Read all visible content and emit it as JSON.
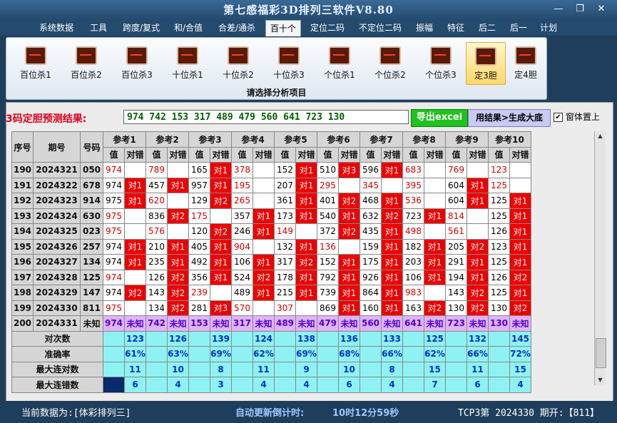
{
  "app_title": "第七感福彩3D排列三软件V8.80",
  "window_buttons": {
    "minimize": "—",
    "restore": "❐",
    "close": "✕"
  },
  "menu": [
    "系统数据",
    "工具",
    "跨度/复式",
    "和/合值",
    "合差/通杀",
    "百十个",
    "定位二码",
    "不定位二码",
    "振幅",
    "特征",
    "后二",
    "后一",
    "计划"
  ],
  "active_menu": "百十个",
  "tools": [
    "百位杀1",
    "百位杀2",
    "百位杀3",
    "十位杀1",
    "十位杀2",
    "十位杀3",
    "个位杀1",
    "个位杀2",
    "个位杀3",
    "定3胆",
    "定4胆"
  ],
  "selected_tool": "定3胆",
  "tool_caption": "请选择分析项目",
  "result": {
    "label": "3码定胆预测结果:",
    "value": "974 742 153 317 489 479 560 641 723 130",
    "export_button": "导出excel",
    "generate_button": "用结果>生成大底",
    "checkbox_label": "窗体置上",
    "checkbox_checked": true
  },
  "table": {
    "head_left": [
      "序号",
      "期号",
      "号码"
    ],
    "ref_headers": [
      "参考1",
      "参考2",
      "参考3",
      "参考4",
      "参考5",
      "参考6",
      "参考7",
      "参考8",
      "参考9",
      "参考10"
    ],
    "sub_headers": [
      "值",
      "对错"
    ],
    "rows": [
      {
        "seq": "190",
        "issue": "2024321",
        "num": "050",
        "refs": [
          [
            "974",
            "",
            1
          ],
          [
            "789",
            "",
            1
          ],
          [
            "165",
            "对1",
            0
          ],
          [
            "378",
            "",
            1
          ],
          [
            "152",
            "对1",
            0
          ],
          [
            "510",
            "对3",
            0
          ],
          [
            "596",
            "对1",
            0
          ],
          [
            "683",
            "",
            1
          ],
          [
            "769",
            "",
            1
          ],
          [
            "123",
            "",
            1
          ]
        ]
      },
      {
        "seq": "191",
        "issue": "2024322",
        "num": "678",
        "refs": [
          [
            "974",
            "对1",
            0
          ],
          [
            "457",
            "对1",
            0
          ],
          [
            "957",
            "对1",
            0
          ],
          [
            "195",
            "",
            1
          ],
          [
            "207",
            "对1",
            0
          ],
          [
            "295",
            "",
            1
          ],
          [
            "345",
            "",
            1
          ],
          [
            "395",
            "",
            1
          ],
          [
            "604",
            "对1",
            0
          ],
          [
            "125",
            "",
            1
          ]
        ]
      },
      {
        "seq": "192",
        "issue": "2024323",
        "num": "914",
        "refs": [
          [
            "975",
            "对1",
            0
          ],
          [
            "620",
            "",
            1
          ],
          [
            "129",
            "对2",
            0
          ],
          [
            "265",
            "",
            1
          ],
          [
            "361",
            "对1",
            0
          ],
          [
            "401",
            "对2",
            0
          ],
          [
            "468",
            "对1",
            0
          ],
          [
            "536",
            "",
            1
          ],
          [
            "604",
            "对1",
            0
          ],
          [
            "125",
            "对1",
            0
          ]
        ]
      },
      {
        "seq": "193",
        "issue": "2024324",
        "num": "630",
        "refs": [
          [
            "975",
            "",
            1
          ],
          [
            "836",
            "对2",
            0
          ],
          [
            "175",
            "",
            1
          ],
          [
            "357",
            "对1",
            0
          ],
          [
            "173",
            "对1",
            0
          ],
          [
            "540",
            "对1",
            0
          ],
          [
            "632",
            "对2",
            0
          ],
          [
            "723",
            "对1",
            0
          ],
          [
            "814",
            "",
            1
          ],
          [
            "125",
            "对1",
            0
          ]
        ]
      },
      {
        "seq": "194",
        "issue": "2024325",
        "num": "023",
        "refs": [
          [
            "975",
            "",
            1
          ],
          [
            "576",
            "",
            1
          ],
          [
            "120",
            "对2",
            0
          ],
          [
            "246",
            "对1",
            0
          ],
          [
            "149",
            "",
            1
          ],
          [
            "372",
            "对2",
            0
          ],
          [
            "435",
            "对1",
            0
          ],
          [
            "498",
            "",
            1
          ],
          [
            "561",
            "",
            1
          ],
          [
            "126",
            "对1",
            0
          ]
        ]
      },
      {
        "seq": "195",
        "issue": "2024326",
        "num": "257",
        "refs": [
          [
            "974",
            "对1",
            0
          ],
          [
            "210",
            "对1",
            0
          ],
          [
            "405",
            "对1",
            0
          ],
          [
            "904",
            "",
            1
          ],
          [
            "132",
            "对1",
            0
          ],
          [
            "136",
            "",
            1
          ],
          [
            "159",
            "对1",
            0
          ],
          [
            "182",
            "对1",
            0
          ],
          [
            "205",
            "对2",
            0
          ],
          [
            "123",
            "对1",
            0
          ]
        ]
      },
      {
        "seq": "196",
        "issue": "2024327",
        "num": "134",
        "refs": [
          [
            "974",
            "对1",
            0
          ],
          [
            "235",
            "对1",
            0
          ],
          [
            "492",
            "对1",
            0
          ],
          [
            "106",
            "对1",
            0
          ],
          [
            "317",
            "对2",
            0
          ],
          [
            "152",
            "对1",
            0
          ],
          [
            "175",
            "对1",
            0
          ],
          [
            "203",
            "对1",
            0
          ],
          [
            "291",
            "对1",
            0
          ],
          [
            "125",
            "对1",
            0
          ]
        ]
      },
      {
        "seq": "197",
        "issue": "2024328",
        "num": "125",
        "refs": [
          [
            "974",
            "",
            1
          ],
          [
            "126",
            "对2",
            0
          ],
          [
            "356",
            "对1",
            0
          ],
          [
            "524",
            "对2",
            0
          ],
          [
            "178",
            "对1",
            0
          ],
          [
            "792",
            "对1",
            0
          ],
          [
            "926",
            "对1",
            0
          ],
          [
            "106",
            "对1",
            0
          ],
          [
            "194",
            "对1",
            0
          ],
          [
            "126",
            "对2",
            0
          ]
        ]
      },
      {
        "seq": "198",
        "issue": "2024329",
        "num": "147",
        "refs": [
          [
            "974",
            "对2",
            0
          ],
          [
            "143",
            "对2",
            0
          ],
          [
            "239",
            "",
            1
          ],
          [
            "489",
            "对1",
            0
          ],
          [
            "215",
            "对1",
            0
          ],
          [
            "739",
            "对1",
            0
          ],
          [
            "864",
            "对1",
            0
          ],
          [
            "983",
            "",
            1
          ],
          [
            "143",
            "对2",
            0
          ],
          [
            "125",
            "对1",
            0
          ]
        ]
      },
      {
        "seq": "199",
        "issue": "2024330",
        "num": "811",
        "refs": [
          [
            "975",
            "",
            1
          ],
          [
            "134",
            "对2",
            0
          ],
          [
            "281",
            "对3",
            0
          ],
          [
            "570",
            "",
            1
          ],
          [
            "307",
            "",
            1
          ],
          [
            "869",
            "对1",
            0
          ],
          [
            "160",
            "对1",
            0
          ],
          [
            "163",
            "对2",
            0
          ],
          [
            "130",
            "对2",
            0
          ],
          [
            "130",
            "对2",
            0
          ]
        ]
      }
    ],
    "unknown_row": {
      "seq": "200",
      "issue": "2024331",
      "num": "未知",
      "values": [
        "974",
        "742",
        "153",
        "317",
        "489",
        "479",
        "560",
        "641",
        "723",
        "130"
      ],
      "unknown_label": "未知"
    },
    "stats": [
      {
        "label": "对次数",
        "values": [
          "123",
          "126",
          "139",
          "124",
          "138",
          "136",
          "133",
          "125",
          "132",
          "145"
        ]
      },
      {
        "label": "准确率",
        "values": [
          "61%",
          "63%",
          "69%",
          "62%",
          "69%",
          "68%",
          "66%",
          "62%",
          "66%",
          "72%"
        ]
      },
      {
        "label": "最大连对数",
        "values": [
          "11",
          "10",
          "8",
          "11",
          "9",
          "10",
          "8",
          "15",
          "11",
          "15"
        ]
      },
      {
        "label": "最大连错数",
        "values": [
          "6",
          "4",
          "3",
          "4",
          "4",
          "6",
          "4",
          "7",
          "6",
          "4"
        ]
      }
    ]
  },
  "status": {
    "data_source": "当前数据为:[体彩排列三]",
    "countdown_label": "自动更新倒计时:",
    "countdown_value": "10时12分59秒",
    "issue_info": "TCP3第 2024330 期开:【811】"
  }
}
